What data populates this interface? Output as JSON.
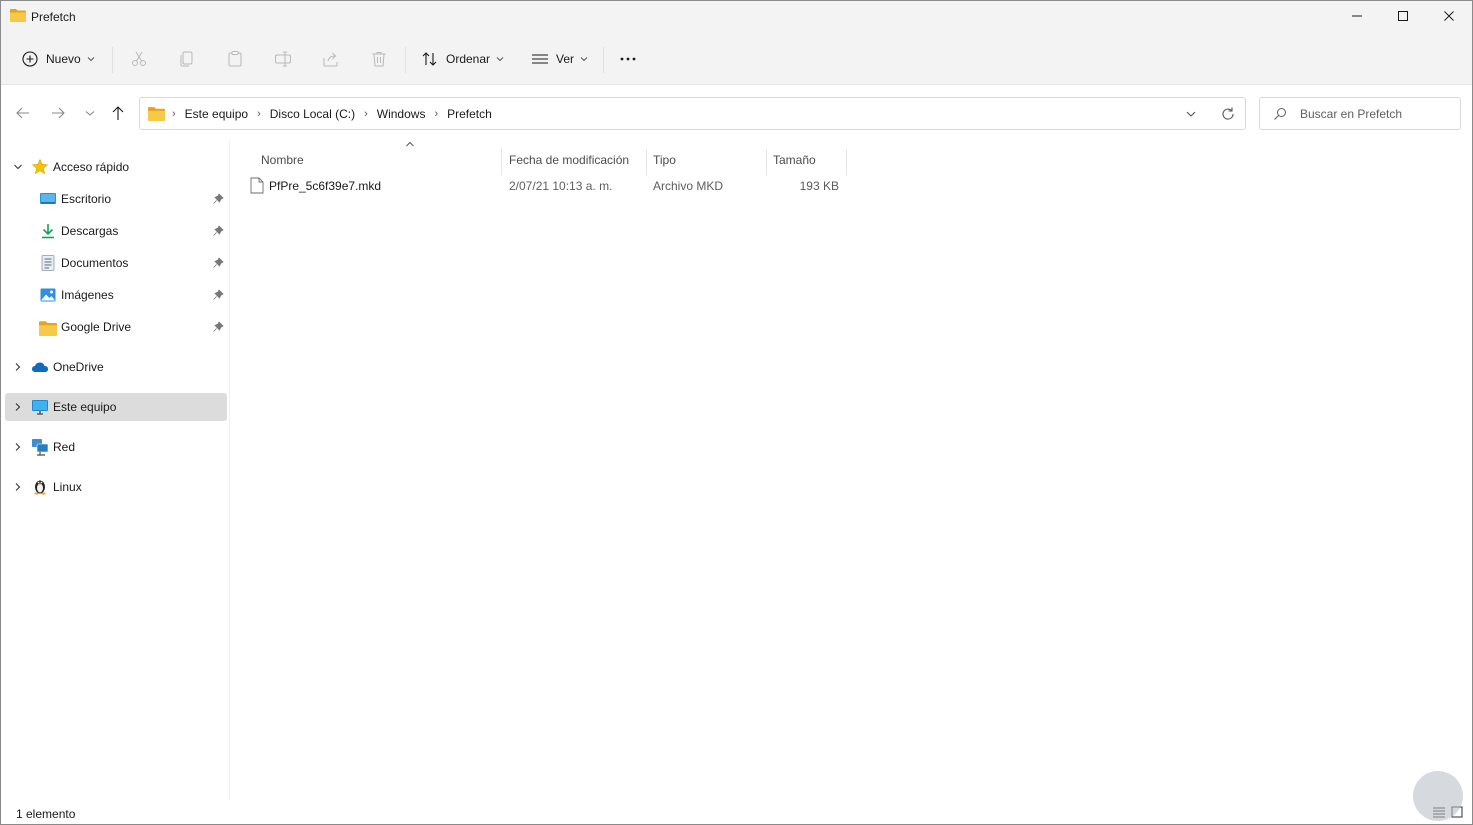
{
  "window": {
    "title": "Prefetch",
    "minimize_icon": "minimize-icon",
    "maximize_icon": "maximize-icon",
    "close_icon": "close-icon"
  },
  "toolbar": {
    "new_label": "Nuevo",
    "sort_label": "Ordenar",
    "view_label": "Ver",
    "disabled_icons": [
      "cut-icon",
      "copy-icon",
      "paste-icon",
      "rename-icon",
      "share-icon",
      "delete-icon"
    ]
  },
  "address": {
    "crumbs": [
      "Este equipo",
      "Disco Local (C:)",
      "Windows",
      "Prefetch"
    ]
  },
  "search": {
    "placeholder": "Buscar en Prefetch"
  },
  "sidebar": {
    "quick_access": "Acceso rápido",
    "pinned": [
      "Escritorio",
      "Descargas",
      "Documentos",
      "Imágenes",
      "Google Drive"
    ],
    "onedrive": "OneDrive",
    "this_pc": "Este equipo",
    "network": "Red",
    "linux": "Linux"
  },
  "columns": {
    "name": "Nombre",
    "modified": "Fecha de modificación",
    "type": "Tipo",
    "size": "Tamaño"
  },
  "files": [
    {
      "name": "PfPre_5c6f39e7.mkd",
      "modified": "2/07/21 10:13 a. m.",
      "type": "Archivo MKD",
      "size": "193 KB"
    }
  ],
  "status": {
    "count": "1 elemento"
  },
  "colors": {
    "accent": "#0067c0",
    "folder": "#f5c342",
    "selected_bg": "#dcdcdc"
  }
}
